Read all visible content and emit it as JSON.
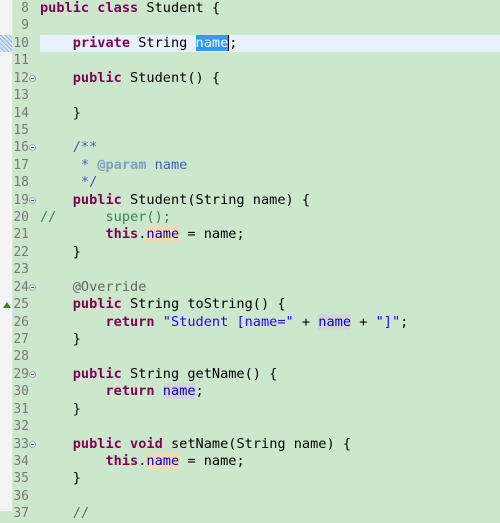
{
  "editor": {
    "language": "java",
    "current_line": 10,
    "colors": {
      "background": "#cce8cc",
      "current_line": "#e8f2fe",
      "keyword": "#7f0055",
      "field": "#0000c0",
      "comment": "#3f7f5f",
      "string": "#2a00ff",
      "selection": "#3399ff"
    },
    "lines": [
      {
        "n": "8",
        "tokens": [
          [
            "kw",
            "public"
          ],
          [
            "",
            ""
          ],
          [
            "plain",
            " "
          ],
          [
            "kw",
            "class"
          ],
          [
            "plain",
            " Student {"
          ]
        ]
      },
      {
        "n": "9",
        "tokens": []
      },
      {
        "n": "10",
        "current": true,
        "tokens": [
          [
            "plain",
            "    "
          ],
          [
            "kw",
            "private"
          ],
          [
            "plain",
            " String "
          ],
          [
            "sel caret",
            "name"
          ],
          [
            "plain",
            ";"
          ]
        ]
      },
      {
        "n": "11",
        "tokens": []
      },
      {
        "n": "12",
        "fold": true,
        "tokens": [
          [
            "plain",
            "    "
          ],
          [
            "kw",
            "public"
          ],
          [
            "plain",
            " Student() {"
          ]
        ]
      },
      {
        "n": "13",
        "tokens": []
      },
      {
        "n": "14",
        "tokens": [
          [
            "plain",
            "    }"
          ]
        ]
      },
      {
        "n": "15",
        "tokens": []
      },
      {
        "n": "16",
        "fold": true,
        "tokens": [
          [
            "javadoc",
            "    /**"
          ]
        ]
      },
      {
        "n": "17",
        "tokens": [
          [
            "javadoc",
            "     * "
          ],
          [
            "jdtag",
            "@param"
          ],
          [
            "javadoc",
            " name"
          ]
        ]
      },
      {
        "n": "18",
        "tokens": [
          [
            "javadoc",
            "     */"
          ]
        ]
      },
      {
        "n": "19",
        "fold": true,
        "tokens": [
          [
            "plain",
            "    "
          ],
          [
            "kw",
            "public"
          ],
          [
            "plain",
            " Student(String name) {"
          ]
        ]
      },
      {
        "n": "20",
        "tokens": [
          [
            "comment",
            "//      super();"
          ]
        ],
        "full": true
      },
      {
        "n": "21",
        "tokens": [
          [
            "plain",
            "        "
          ],
          [
            "kw",
            "this"
          ],
          [
            "plain",
            "."
          ],
          [
            "field occ-write",
            "name"
          ],
          [
            "plain",
            " = name;"
          ]
        ]
      },
      {
        "n": "22",
        "tokens": [
          [
            "plain",
            "    }"
          ]
        ]
      },
      {
        "n": "23",
        "tokens": []
      },
      {
        "n": "24",
        "fold": true,
        "tokens": [
          [
            "annotation",
            "    @Override"
          ]
        ]
      },
      {
        "n": "25",
        "override": true,
        "tokens": [
          [
            "plain",
            "    "
          ],
          [
            "kw",
            "public"
          ],
          [
            "plain",
            " String toString() {"
          ]
        ]
      },
      {
        "n": "26",
        "tokens": [
          [
            "plain",
            "        "
          ],
          [
            "kw",
            "return"
          ],
          [
            "plain",
            " "
          ],
          [
            "string",
            "\"Student [name=\""
          ],
          [
            "plain",
            " + "
          ],
          [
            "field occ-read",
            "name"
          ],
          [
            "plain",
            " + "
          ],
          [
            "string",
            "\"]\""
          ],
          [
            "plain",
            ";"
          ]
        ]
      },
      {
        "n": "27",
        "tokens": [
          [
            "plain",
            "    }"
          ]
        ]
      },
      {
        "n": "28",
        "tokens": []
      },
      {
        "n": "29",
        "fold": true,
        "tokens": [
          [
            "plain",
            "    "
          ],
          [
            "kw",
            "public"
          ],
          [
            "plain",
            " String getName() {"
          ]
        ]
      },
      {
        "n": "30",
        "tokens": [
          [
            "plain",
            "        "
          ],
          [
            "kw",
            "return"
          ],
          [
            "plain",
            " "
          ],
          [
            "field occ-read",
            "name"
          ],
          [
            "plain",
            ";"
          ]
        ]
      },
      {
        "n": "31",
        "tokens": [
          [
            "plain",
            "    }"
          ]
        ]
      },
      {
        "n": "32",
        "tokens": []
      },
      {
        "n": "33",
        "fold": true,
        "tokens": [
          [
            "plain",
            "    "
          ],
          [
            "kw",
            "public"
          ],
          [
            "plain",
            " "
          ],
          [
            "kw",
            "void"
          ],
          [
            "plain",
            " setName(String name) {"
          ]
        ]
      },
      {
        "n": "34",
        "tokens": [
          [
            "plain",
            "        "
          ],
          [
            "kw",
            "this"
          ],
          [
            "plain",
            "."
          ],
          [
            "field occ-write",
            "name"
          ],
          [
            "plain",
            " = name;"
          ]
        ]
      },
      {
        "n": "35",
        "tokens": [
          [
            "plain",
            "    }"
          ]
        ]
      },
      {
        "n": "36",
        "tokens": []
      },
      {
        "n": "37",
        "tokens": [
          [
            "comment",
            "    //"
          ]
        ]
      }
    ]
  }
}
